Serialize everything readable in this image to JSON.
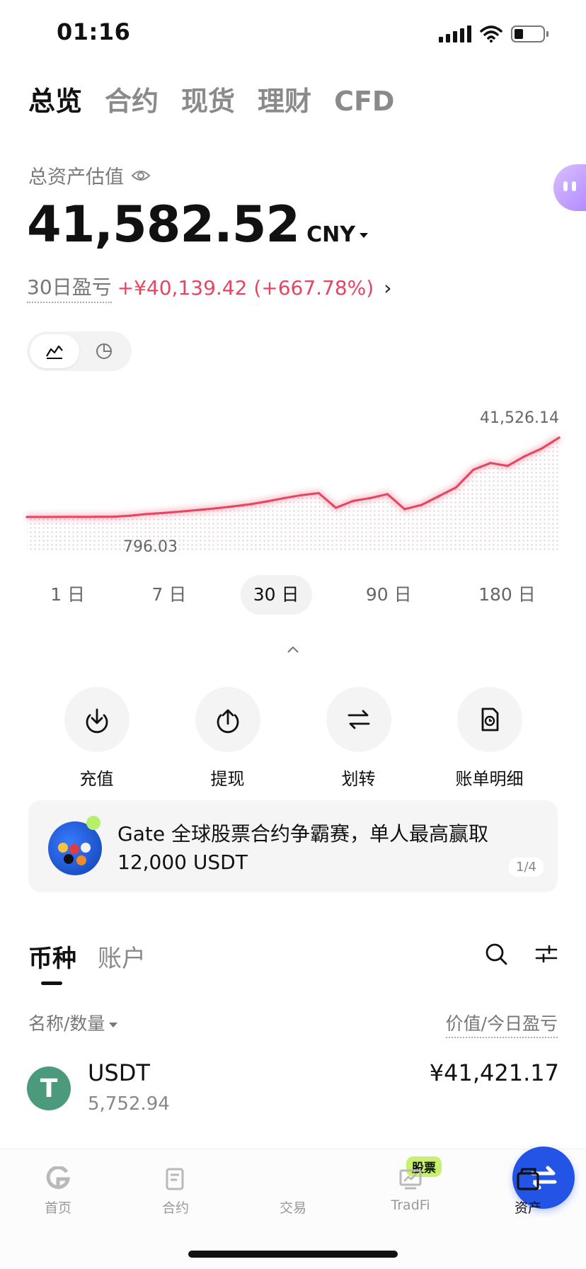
{
  "status_bar": {
    "time": "01:16"
  },
  "top_tabs": [
    {
      "label": "总览",
      "active": true
    },
    {
      "label": "合约",
      "active": false
    },
    {
      "label": "现货",
      "active": false
    },
    {
      "label": "理财",
      "active": false
    },
    {
      "label": "CFD",
      "active": false
    }
  ],
  "overview": {
    "label": "总资产估值",
    "total_value": "41,582.52",
    "currency": "CNY",
    "pnl_label": "30日盈亏",
    "pnl_value": "+¥40,139.42 (+667.78%)"
  },
  "chart_data": {
    "type": "line",
    "x": [
      "d1",
      "d2",
      "d3",
      "d4",
      "d5",
      "d6",
      "d7",
      "d8",
      "d9",
      "d10",
      "d11",
      "d12",
      "d13",
      "d14",
      "d15",
      "d16",
      "d17",
      "d18",
      "d19",
      "d20",
      "d21",
      "d22",
      "d23",
      "d24",
      "d25",
      "d26",
      "d27",
      "d28",
      "d29",
      "d30",
      "d31",
      "d32"
    ],
    "values": [
      800,
      796.03,
      820,
      840,
      860,
      870,
      1400,
      2300,
      2900,
      3600,
      4400,
      5200,
      6200,
      7300,
      8800,
      10500,
      12000,
      13000,
      5500,
      9000,
      10500,
      12500,
      4800,
      7000,
      11500,
      16000,
      25000,
      28500,
      27000,
      32000,
      36000,
      41526.14
    ],
    "max_label": "41,526.14",
    "min_label": "796.03",
    "color": "#e64562"
  },
  "time_ranges": [
    {
      "label": "1 日",
      "active": false
    },
    {
      "label": "7 日",
      "active": false
    },
    {
      "label": "30 日",
      "active": true
    },
    {
      "label": "90 日",
      "active": false
    },
    {
      "label": "180 日",
      "active": false
    }
  ],
  "actions": [
    {
      "label": "充值",
      "icon": "deposit-icon"
    },
    {
      "label": "提现",
      "icon": "withdraw-icon"
    },
    {
      "label": "划转",
      "icon": "transfer-icon"
    },
    {
      "label": "账单明细",
      "icon": "bill-icon"
    }
  ],
  "banner": {
    "text": "Gate 全球股票合约争霸赛，单人最高赢取 12,000 USDT",
    "pager": "1/4"
  },
  "sub_tabs": [
    {
      "label": "币种",
      "active": true
    },
    {
      "label": "账户",
      "active": false
    }
  ],
  "list_header": {
    "left": "名称/数量",
    "right": "价值/今日盈亏"
  },
  "assets": [
    {
      "symbol": "USDT",
      "quantity": "5,752.94",
      "value": "¥41,421.17",
      "coin_glyph": "T"
    }
  ],
  "bottom_nav": [
    {
      "label": "首页",
      "active": false
    },
    {
      "label": "合约",
      "active": false
    },
    {
      "label": "交易",
      "active": false
    },
    {
      "label": "TradFi",
      "active": false,
      "badge": "股票"
    },
    {
      "label": "资产",
      "active": true
    }
  ]
}
